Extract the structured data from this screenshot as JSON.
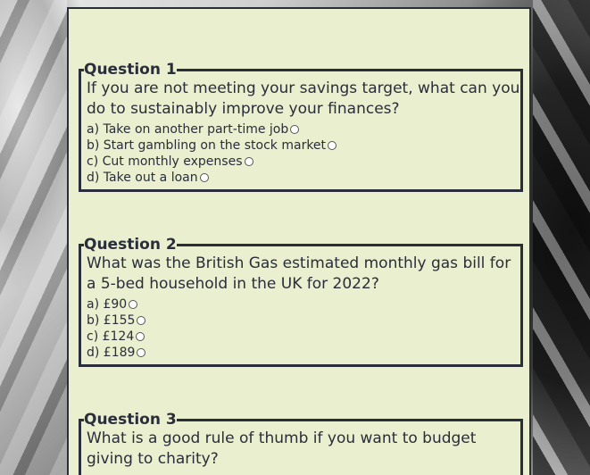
{
  "quiz": {
    "questions": [
      {
        "legend": "Question 1",
        "text": "If you are not meeting your savings target, what can you do to sustainably improve your finances?",
        "options": [
          "a) Take on another part-time job",
          "b) Start gambling on the stock market",
          "c) Cut monthly expenses",
          "d) Take out a loan"
        ]
      },
      {
        "legend": "Question 2",
        "text": "What was the British Gas estimated monthly gas bill for a 5-bed household in the UK for 2022?",
        "options": [
          "a) £90",
          "b) £155",
          "c) £124",
          "d) £189"
        ]
      },
      {
        "legend": "Question 3",
        "text": "What is a good rule of thumb if you want to budget giving to charity?",
        "options": []
      }
    ]
  }
}
